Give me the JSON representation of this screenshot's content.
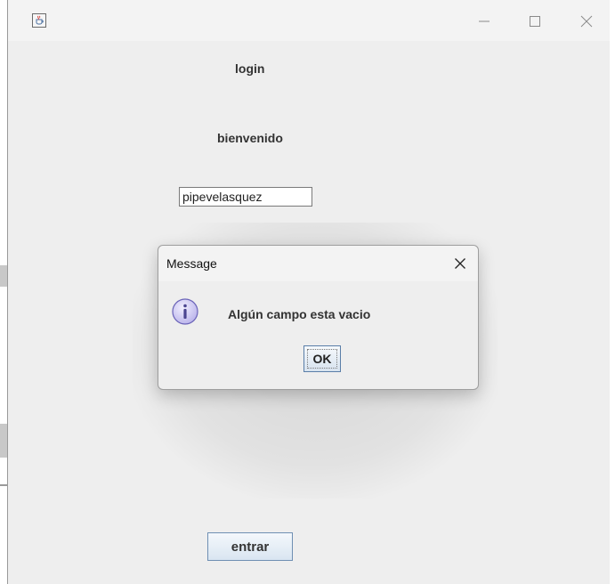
{
  "window": {
    "app_icon": "java-cup-icon",
    "controls": {
      "minimize_icon": "minimize-icon",
      "maximize_icon": "maximize-icon",
      "close_icon": "close-icon"
    }
  },
  "form": {
    "title_label": "login",
    "welcome_label": "bienvenido",
    "username_value": "pipevelasquez",
    "enter_button": "entrar"
  },
  "dialog": {
    "title": "Message",
    "icon": "info-icon",
    "message": "Algún campo esta vacio",
    "ok_button": "OK",
    "close_icon": "close-icon"
  },
  "colors": {
    "window_bg": "#eeeeee",
    "button_border": "#6f8fb3",
    "info_icon_fill": "#c9c4f0"
  }
}
